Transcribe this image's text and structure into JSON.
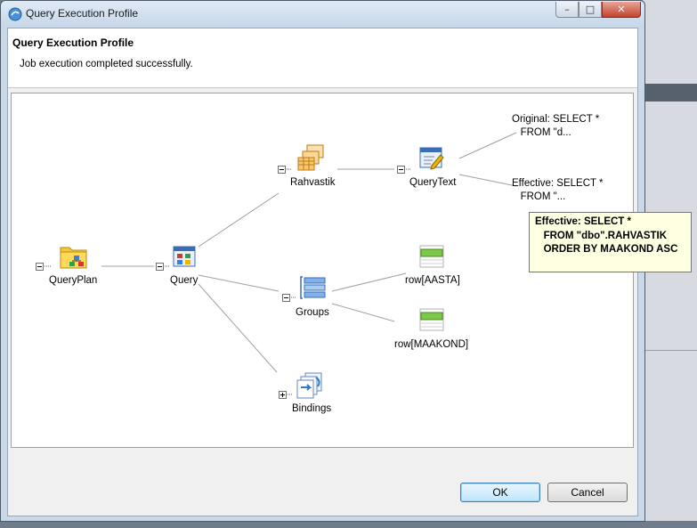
{
  "window": {
    "title": "Query Execution Profile",
    "minimize_glyph": "–",
    "maximize_glyph": "□",
    "close_glyph": "✕"
  },
  "header": {
    "title": "Query Execution Profile",
    "message": "Job execution completed successfully."
  },
  "tree": {
    "nodes": {
      "queryplan": "QueryPlan",
      "query": "Query",
      "rahvastik": "Rahvastik",
      "querytext": "QueryText",
      "groups": "Groups",
      "row_aasta": "row[AASTA]",
      "row_maakond": "row[MAAKOND]",
      "bindings": "Bindings"
    },
    "leaves": {
      "original": "Original: SELECT *\n   FROM \"d...",
      "effective": "Effective: SELECT *\n   FROM \"..."
    },
    "icons": {
      "queryplan": "folder-diagram-icon",
      "query": "query-grid-icon",
      "rahvastik": "table-stack-icon",
      "querytext": "edit-text-icon",
      "groups": "group-list-icon",
      "row": "row-icon",
      "bindings": "bindings-icon"
    }
  },
  "tooltip": {
    "line1": "Effective: SELECT *",
    "line2": "   FROM \"dbo\".RAHVASTIK",
    "line3": "   ORDER BY MAAKOND ASC"
  },
  "buttons": {
    "ok": "OK",
    "cancel": "Cancel"
  }
}
